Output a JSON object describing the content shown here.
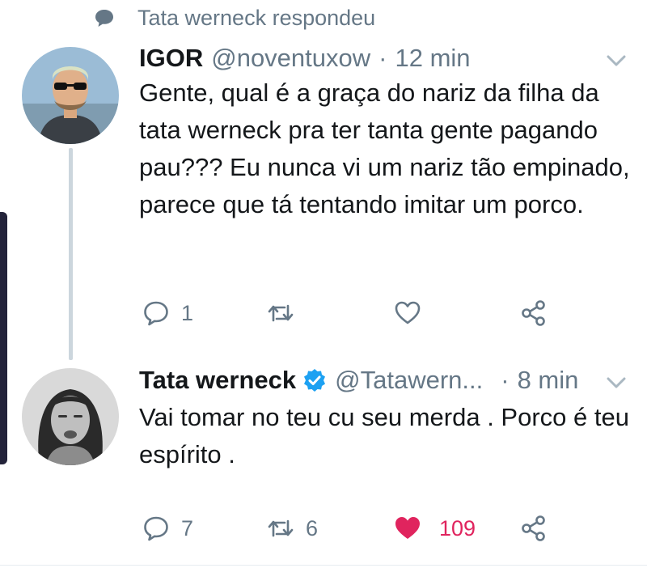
{
  "context": {
    "label": "Tata werneck respondeu",
    "icon": "chat-bubble-icon"
  },
  "tweet1": {
    "name": "IGOR",
    "handle": "@noventuxow",
    "separator": "·",
    "time": "12 min",
    "text": "Gente, qual é a graça do nariz da filha da tata werneck pra ter tanta gente pagando pau??? Eu nunca vi um nariz tão empinado, parece que tá tentando imitar um porco.",
    "actions": {
      "replies": "1",
      "retweets": "",
      "likes": ""
    }
  },
  "tweet2": {
    "name": "Tata werneck",
    "handle": "@Tatawern...",
    "separator": "·",
    "time": "8 min",
    "verified": true,
    "text": "Vai tomar no teu cu seu merda . Porco é teu espírito .",
    "actions": {
      "replies": "7",
      "retweets": "6",
      "likes": "109"
    }
  },
  "colors": {
    "accent": "#1da1f2",
    "like": "#e0245e",
    "muted": "#657786",
    "text": "#14171a"
  }
}
